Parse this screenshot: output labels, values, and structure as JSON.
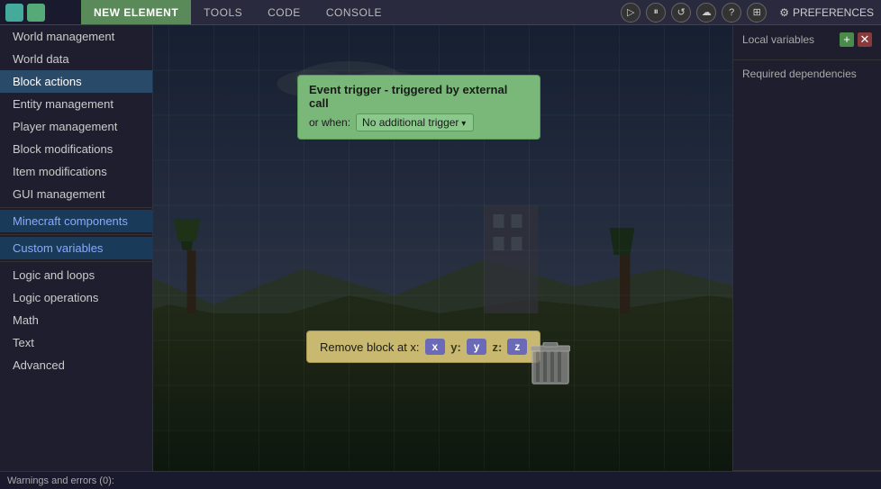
{
  "topbar": {
    "tabs": [
      {
        "label": "NEW ELEMENT",
        "active": true
      },
      {
        "label": "TOOLS",
        "active": false
      },
      {
        "label": "CODE",
        "active": false
      },
      {
        "label": "CONSOLE",
        "active": false
      }
    ],
    "preferences_label": "PREFERENCES",
    "icons": [
      "▶",
      "⏸",
      "↺",
      "☁",
      "?",
      "⊞"
    ]
  },
  "sidebar": {
    "items": [
      {
        "label": "World management",
        "type": "item"
      },
      {
        "label": "World data",
        "type": "item"
      },
      {
        "label": "Block actions",
        "type": "item",
        "active": true
      },
      {
        "label": "Entity management",
        "type": "item"
      },
      {
        "label": "Player management",
        "type": "item"
      },
      {
        "label": "Block modifications",
        "type": "item"
      },
      {
        "label": "Item modifications",
        "type": "item"
      },
      {
        "label": "GUI management",
        "type": "item"
      },
      {
        "label": "",
        "type": "divider"
      },
      {
        "label": "Minecraft components",
        "type": "item",
        "highlighted": true
      },
      {
        "label": "",
        "type": "divider"
      },
      {
        "label": "Custom variables",
        "type": "item",
        "highlighted": true
      },
      {
        "label": "",
        "type": "divider"
      },
      {
        "label": "Logic and loops",
        "type": "item"
      },
      {
        "label": "Logic operations",
        "type": "item"
      },
      {
        "label": "Math",
        "type": "item"
      },
      {
        "label": "Text",
        "type": "item"
      },
      {
        "label": "Advanced",
        "type": "item"
      }
    ]
  },
  "canvas": {
    "event_trigger": {
      "title": "Event trigger - triggered by external call",
      "or_when_label": "or when:",
      "dropdown_value": "No additional trigger"
    },
    "remove_block": {
      "label": "Remove block at  x:",
      "x_val": "x",
      "y_label": "y:",
      "y_val": "y",
      "z_label": "z:",
      "z_val": "z"
    }
  },
  "right_panel": {
    "local_variables": {
      "label": "Local variables",
      "add_label": "+",
      "remove_label": "✕"
    },
    "required_dependencies": {
      "label": "Required dependencies"
    }
  },
  "status_bar": {
    "label": "Warnings and errors (0):"
  }
}
